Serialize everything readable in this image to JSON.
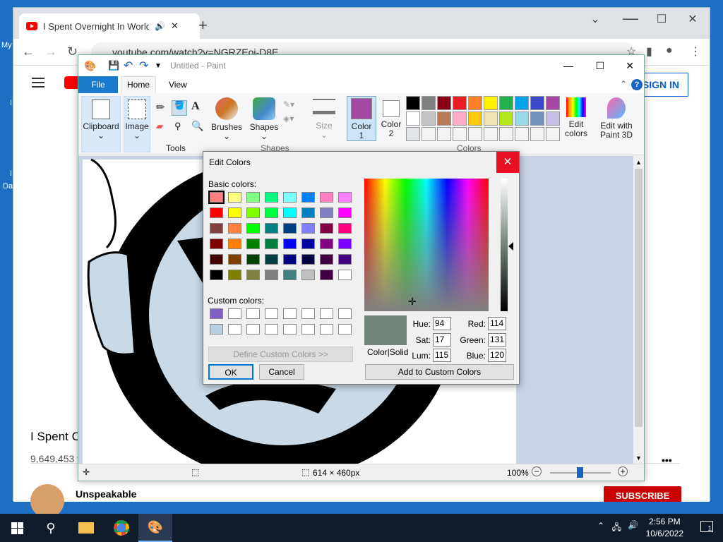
{
  "desktop": {
    "left_labels": [
      "My",
      "I",
      "I",
      "Da"
    ]
  },
  "chrome": {
    "tab_title": "I Spent Overnight In Worlds",
    "new_tab": "+",
    "url": "youtube.com/watch?v=NGRZEoi-D8E",
    "controls": {
      "minimize": "⌄",
      "restore": "☐",
      "close": "✕"
    }
  },
  "youtube": {
    "sign_in": "SIGN IN",
    "video_title": "I Spent C",
    "views": "9,649,453 v",
    "channel": "Unspeakable",
    "subscribe": "SUBSCRIBE",
    "more": "•••"
  },
  "paint": {
    "window_title": "Untitled - Paint",
    "menu": {
      "file": "File",
      "home": "Home",
      "view": "View"
    },
    "ribbon": {
      "clipboard": "Clipboard",
      "image": "Image",
      "tools": "Tools",
      "brushes": "Brushes",
      "shapes": "Shapes",
      "size": "Size",
      "color1": "Color 1",
      "color2": "Color 2",
      "colors": "Colors",
      "edit_colors": "Edit colors",
      "edit_paint3d": "Edit with Paint 3D",
      "colors_group_label": "Colors",
      "shapes_group_label": "Shapes"
    },
    "sign_in": "SIGN IN",
    "palette_row1": [
      "#000000",
      "#7f7f7f",
      "#880015",
      "#ed1c24",
      "#ff7f27",
      "#fff200",
      "#22b14c",
      "#00a2e8",
      "#3f48cc",
      "#a349a4"
    ],
    "palette_row2": [
      "#ffffff",
      "#c3c3c3",
      "#b97a57",
      "#ffaec9",
      "#ffc90e",
      "#efe4b0",
      "#b5e61d",
      "#99d9ea",
      "#7092be",
      "#c8bfe7"
    ],
    "palette_row3": [
      "#e0e4e8",
      "#f4f4f4",
      "#f4f4f4",
      "#f4f4f4",
      "#f4f4f4",
      "#f4f4f4",
      "#f4f4f4",
      "#f4f4f4",
      "#f4f4f4",
      "#f4f4f4"
    ],
    "color1_hex": "#a349a4",
    "status": {
      "size": "614 × 460px",
      "zoom": "100%"
    }
  },
  "dialog": {
    "title": "Edit Colors",
    "basic_label": "Basic colors:",
    "custom_label": "Custom colors:",
    "define_custom": "Define Custom Colors >>",
    "ok": "OK",
    "cancel": "Cancel",
    "add_custom": "Add to Custom Colors",
    "color_solid": "Color|Solid",
    "hue_label": "Hue:",
    "sat_label": "Sat:",
    "lum_label": "Lum:",
    "red_label": "Red:",
    "green_label": "Green:",
    "blue_label": "Blue:",
    "hue": "94",
    "sat": "17",
    "lum": "115",
    "red": "114",
    "green": "131",
    "blue": "120",
    "preview_color": "#728378",
    "basic_colors": [
      [
        "#ff8080",
        "#ffff80",
        "#80ff80",
        "#00ff80",
        "#80ffff",
        "#0080ff",
        "#ff80c0",
        "#ff80ff"
      ],
      [
        "#ff0000",
        "#ffff00",
        "#80ff00",
        "#00ff40",
        "#00ffff",
        "#0080c0",
        "#8080c0",
        "#ff00ff"
      ],
      [
        "#804040",
        "#ff8040",
        "#00ff00",
        "#008080",
        "#004080",
        "#8080ff",
        "#800040",
        "#ff0080"
      ],
      [
        "#800000",
        "#ff8000",
        "#008000",
        "#008040",
        "#0000ff",
        "#0000a0",
        "#800080",
        "#8000ff"
      ],
      [
        "#400000",
        "#804000",
        "#004000",
        "#004040",
        "#000080",
        "#000040",
        "#400040",
        "#400080"
      ],
      [
        "#000000",
        "#808000",
        "#808040",
        "#808080",
        "#408080",
        "#c0c0c0",
        "#400040",
        "#ffffff"
      ]
    ],
    "custom_colors": [
      [
        "#8060c0",
        "#ffffff",
        "#ffffff",
        "#ffffff",
        "#ffffff",
        "#ffffff",
        "#ffffff",
        "#ffffff"
      ],
      [
        "#b8cfe0",
        "#ffffff",
        "#ffffff",
        "#ffffff",
        "#ffffff",
        "#ffffff",
        "#ffffff",
        "#ffffff"
      ]
    ]
  },
  "taskbar": {
    "time": "2:56 PM",
    "date": "10/6/2022",
    "notif": "1"
  }
}
